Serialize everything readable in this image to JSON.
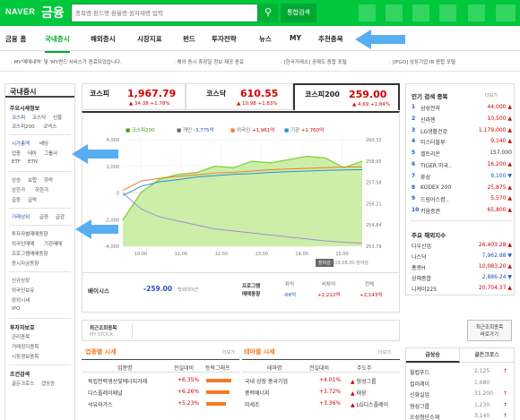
{
  "header": {
    "logo": "NAVER",
    "service": "금융",
    "search_placeholder": "종목명·펀드명·환율명·원자재명 입력",
    "search_icon": "search-icon",
    "integrated_search": "통합검색"
  },
  "nav": [
    "금융 홈",
    "국내증시",
    "해외증시",
    "시장지표",
    "펀드",
    "투자전략",
    "뉴스",
    "MY",
    "추천종목"
  ],
  "notices": [
    "· MY'메매내역' 및 'MY펀드'서비스가 종료되었습니다.",
    "· 해외 증시 휴장일 정보 제공 종료",
    "· [한국거래소] 공매도 종합 포털",
    "· [IFGO] 상장기업 IR 종합 포털"
  ],
  "sidebar": {
    "title": "국내증시",
    "sections": [
      {
        "head": "주요시세정보",
        "rows": [
          [
            "코스피",
            "코스닥",
            "선물"
          ],
          [
            "코스피200",
            "코넥스"
          ]
        ]
      },
      {
        "head": "",
        "rows": [
          [
            "시가총액",
            "배당"
          ],
          [
            "업종",
            "테마",
            "그룹사"
          ],
          [
            "ETF",
            "ETN"
          ]
        ]
      },
      {
        "head": "",
        "rows": [
          [
            "상승",
            "보합",
            "하락"
          ],
          [
            "상한가",
            "하한가"
          ],
          [
            "급등",
            "급락"
          ]
        ]
      },
      {
        "head": "",
        "rows": [
          [
            "거래상위",
            "급증",
            "급감"
          ]
        ]
      },
      {
        "head": "",
        "rows": [
          [
            "투자자별매매동향"
          ],
          [
            "외국인매매",
            "기관매매"
          ],
          [
            "프로그램매매동향"
          ],
          [
            "증시자금동향"
          ]
        ]
      },
      {
        "head": "",
        "rows": [
          [
            "신규상장"
          ],
          [
            "외국인보유"
          ],
          [
            "장외시세"
          ],
          [
            "IPO"
          ]
        ]
      },
      {
        "head": "투자자보호",
        "rows": [
          [
            "관리종목"
          ],
          [
            "거래정지종목"
          ],
          [
            "시장경보종목"
          ]
        ]
      },
      {
        "head": "조건검색",
        "rows": [
          [
            "골든크로스",
            "갭상승"
          ]
        ]
      }
    ]
  },
  "indices": [
    {
      "name": "코스피",
      "value": "1,967.79",
      "change": "▲ 34.38 +1.78%"
    },
    {
      "name": "코스닥",
      "value": "610.55",
      "change": "▲ 10.98 +1.83%"
    },
    {
      "name": "코스피200",
      "value": "259.00",
      "change": "▲ 4.69 +1.84%"
    }
  ],
  "chart_data": {
    "type": "line",
    "legend": [
      {
        "name": "코스피200",
        "value": "",
        "color": "#7fd13b"
      },
      {
        "name": "개인",
        "value": "-3,775억",
        "color": "#888888"
      },
      {
        "name": "외국인",
        "value": "+1,961억",
        "color": "#f07b28"
      },
      {
        "name": "기관",
        "value": "+1,760억",
        "color": "#2a8dd4"
      }
    ],
    "x_ticks": [
      "10:00",
      "11:00",
      "12:00",
      "13:00",
      "14:00",
      "15:00"
    ],
    "y_left_ticks": [
      "4,000",
      "2,000",
      "0",
      "-2,000",
      "-4,000"
    ],
    "y_right_ticks": [
      "260.32",
      "258.95",
      "257.58",
      "256.21",
      "254.84",
      "253.79"
    ],
    "ylim_left": [
      -4000,
      4000
    ],
    "ylim_right": [
      253.79,
      260.32
    ],
    "series": [
      {
        "name": "코스피200",
        "color": "#7fd13b",
        "values": [
          255.4,
          257.1,
          257.9,
          258.2,
          258.3,
          258.7,
          258.6,
          259.0,
          258.9,
          259.1,
          259.3,
          259.2,
          258.6,
          259.0
        ]
      },
      {
        "name": "외국인",
        "color": "#f07b28",
        "values": [
          200,
          900,
          1100,
          1250,
          1350,
          1500,
          1550,
          1650,
          1750,
          1800,
          1850,
          1900,
          1950,
          1961
        ]
      },
      {
        "name": "기관",
        "color": "#2a8dd4",
        "values": [
          -200,
          500,
          850,
          1000,
          1200,
          1300,
          1400,
          1450,
          1550,
          1600,
          1650,
          1700,
          1730,
          1760
        ]
      },
      {
        "name": "개인",
        "color": "#a58cd6",
        "values": [
          0,
          -1200,
          -1800,
          -2100,
          -2400,
          -2700,
          -2850,
          -3000,
          -3150,
          -3300,
          -3450,
          -3600,
          -3700,
          -3775
        ]
      }
    ],
    "closed_badge": "장마감",
    "timestamp": "2019.08.30 장마감"
  },
  "basis": {
    "label": "베이시스",
    "value": "-259.00",
    "note": "백워데이션"
  },
  "program": {
    "label1": "프로그램",
    "label2": "매매동향",
    "cols": [
      "차익",
      "비차익",
      "전체"
    ],
    "vals": [
      "-68억",
      "+2,212억",
      "+2,143억"
    ]
  },
  "right_panel": {
    "title": "인기 검색 종목",
    "more": "더보기",
    "items": [
      {
        "rank": "1",
        "name": "삼성전자",
        "val": "44,000",
        "dir": "up"
      },
      {
        "rank": "2",
        "name": "신라젠",
        "val": "10,500",
        "dir": "up"
      },
      {
        "rank": "3",
        "name": "LG생활건강",
        "val": "1,179,000",
        "dir": "up"
      },
      {
        "rank": "4",
        "name": "미스터블루",
        "val": "9,140",
        "dir": "up"
      },
      {
        "rank": "5",
        "name": "셀트리온",
        "val": "157,000",
        "dir": "none"
      },
      {
        "rank": "6",
        "name": "TIGER 미국..",
        "val": "16,200",
        "dir": "up"
      },
      {
        "rank": "7",
        "name": "휴성",
        "val": "9,100",
        "dir": "dn"
      },
      {
        "rank": "8",
        "name": "KODEX 200",
        "val": "25,875",
        "dir": "up"
      },
      {
        "rank": "9",
        "name": "드림어스컴..",
        "val": "5,570",
        "dir": "up"
      },
      {
        "rank": "10",
        "name": "키움증권",
        "val": "65,800",
        "dir": "up"
      }
    ],
    "title2": "주요 해외지수",
    "world": [
      {
        "name": "다우산업",
        "val": "26,403.28",
        "dir": "up"
      },
      {
        "name": "나스닥",
        "val": "7,962.88",
        "dir": "dn"
      },
      {
        "name": "홍콩H",
        "val": "10,083.20",
        "dir": "up"
      },
      {
        "name": "상해종합",
        "val": "2,886.24",
        "dir": "dn"
      },
      {
        "name": "니케이225",
        "val": "20,704.37",
        "dir": "up"
      }
    ]
  },
  "recent": {
    "title": "최근조회종목",
    "sub": "MY STOCK",
    "btn1": "최근조회종목",
    "btn2": "바로가기"
  },
  "sector": {
    "title": "업종별 시세",
    "more": "더보기",
    "cols": [
      "업종명",
      "전일대비",
      "등락그래프"
    ],
    "rows": [
      [
        "독립전력생산및에너지거래",
        "+6.35%"
      ],
      [
        "디스플레이패널",
        "+6.26%"
      ],
      [
        "석유와가스",
        "+5.23%"
      ]
    ]
  },
  "theme": {
    "title": "테마별 시세",
    "more": "더보기",
    "cols": [
      "테마명",
      "전일대비",
      "주도주"
    ],
    "rows": [
      [
        "국내 상장 중국기업",
        "+4.01%",
        "형성그룹"
      ],
      [
        "풍력에너지",
        "+3.72%",
        "태웅"
      ],
      [
        "미세조",
        "+3.36%",
        "LG디스플레이"
      ]
    ]
  },
  "bottom_right": {
    "tab1": "급상승",
    "tab2": "골든크로스",
    "rows": [
      [
        "월컵푸드",
        "2,125",
        "up"
      ],
      [
        "컬러레이",
        "1,680",
        "none"
      ],
      [
        "신화실업",
        "31,200",
        "up"
      ],
      [
        "형성그룹",
        "1,230",
        "up"
      ],
      [
        "오성첨단소재",
        "3,140",
        "up"
      ]
    ]
  }
}
